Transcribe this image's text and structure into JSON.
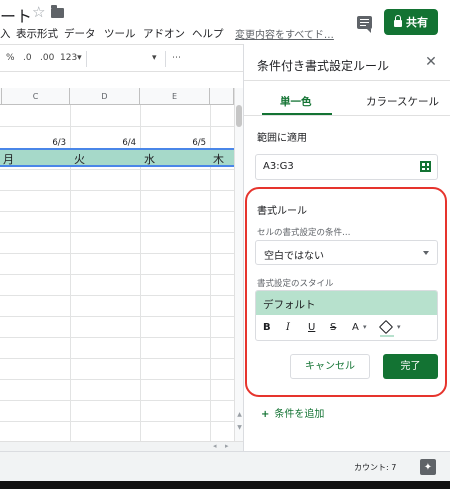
{
  "header": {
    "doc_title": "ート",
    "menu": [
      "入",
      "表示形式",
      "データ",
      "ツール",
      "アドオン",
      "ヘルプ"
    ],
    "last_edit": "変更内容をすべてド…",
    "share_label": "共有"
  },
  "toolbar": {
    "percent": "%",
    "dec_decrease": ".0",
    "dec_increase": ".00",
    "number_format": "123▾",
    "more": "⋯"
  },
  "sheet": {
    "columns": [
      "C",
      "D",
      "E"
    ],
    "dates": [
      "6/3",
      "6/4",
      "6/5"
    ],
    "days": [
      "月",
      "火",
      "水",
      "木"
    ]
  },
  "panel": {
    "title": "条件付き書式設定ルール",
    "tabs": [
      "単一色",
      "カラースケール"
    ],
    "range_label": "範囲に適用",
    "range_value": "A3:G3",
    "rule_heading": "書式ルール",
    "condition_label": "セルの書式設定の条件…",
    "condition_value": "空白ではない",
    "style_label": "書式設定のスタイル",
    "style_preview": "デフォルト",
    "format_buttons": [
      "B",
      "I",
      "U",
      "S",
      "A"
    ],
    "cancel_label": "キャンセル",
    "done_label": "完了",
    "add_rule_label": "条件を追加"
  },
  "status": {
    "count_label": "カウント: 7"
  },
  "colors": {
    "accent_green": "#137333",
    "highlight": "#a6d9c9",
    "preview_fill": "#b7e1cd",
    "annotation_red": "#e6342d"
  }
}
